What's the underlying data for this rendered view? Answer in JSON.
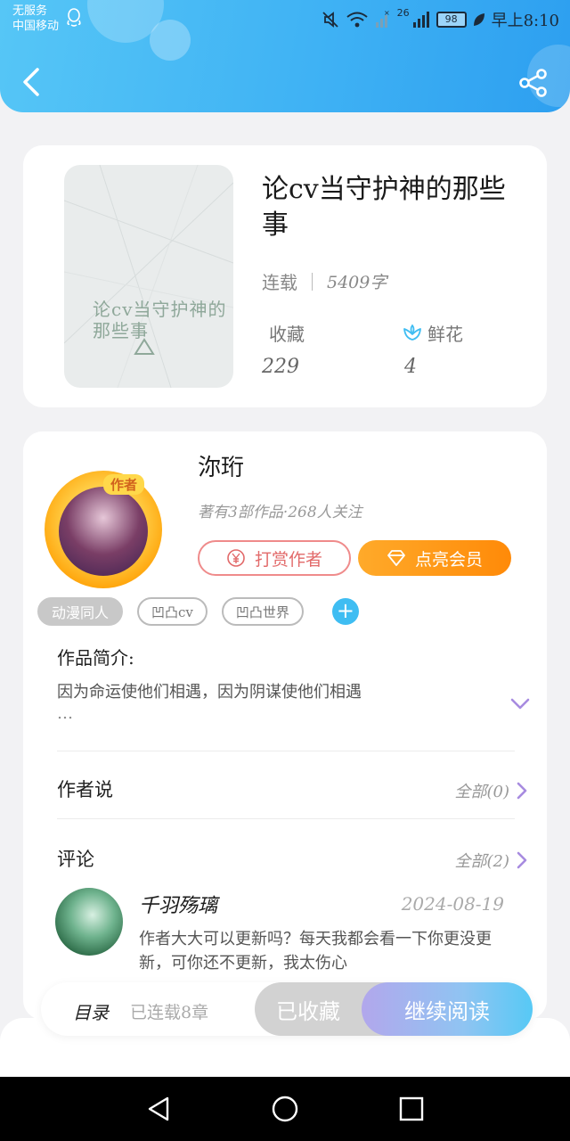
{
  "status_bar": {
    "carrier_line1": "无服务",
    "carrier_line2": "中国移动",
    "network": "26",
    "battery": "98",
    "time": "早上8:10"
  },
  "header": {
    "back_icon": "chevron-left-icon",
    "share_icon": "share-icon"
  },
  "book": {
    "cover_title": "论cv当守护神的那些事",
    "title": "论cv当守护神的那些事",
    "status": "连载",
    "word_count": "5409字",
    "favorites_label": "收藏",
    "favorites_value": "229",
    "flowers_label": "鲜花",
    "flowers_value": "4"
  },
  "author": {
    "badge": "作者",
    "name": "沵珩",
    "summary": "著有3部作品·268人关注",
    "tip_label": "打赏作者",
    "vip_label": "点亮会员"
  },
  "tags": [
    "动漫同人",
    "凹凸cv",
    "凹凸世界"
  ],
  "intro": {
    "label": "作品简介:",
    "text": "因为命运使他们相遇，因为阴谋使他们相遇",
    "ellipsis": "…"
  },
  "author_says": {
    "label": "作者说",
    "more": "全部(0)"
  },
  "comments": {
    "label": "评论",
    "more": "全部(2)",
    "items": [
      {
        "user": "千羽殇璃",
        "date": "2024-08-19",
        "text": "作者大大可以更新吗？每天我都会看一下你更没更新，可你还不更新，我太伤心"
      }
    ]
  },
  "bottom_bar": {
    "toc_label": "目录",
    "toc_sub": "已连载8章",
    "collected_label": "已收藏",
    "read_label": "继续阅读"
  },
  "colors": {
    "header": "#3fb2f4",
    "vip": "#ff9a14",
    "tip": "#e26a6a",
    "accent_purple": "#a78be0"
  }
}
